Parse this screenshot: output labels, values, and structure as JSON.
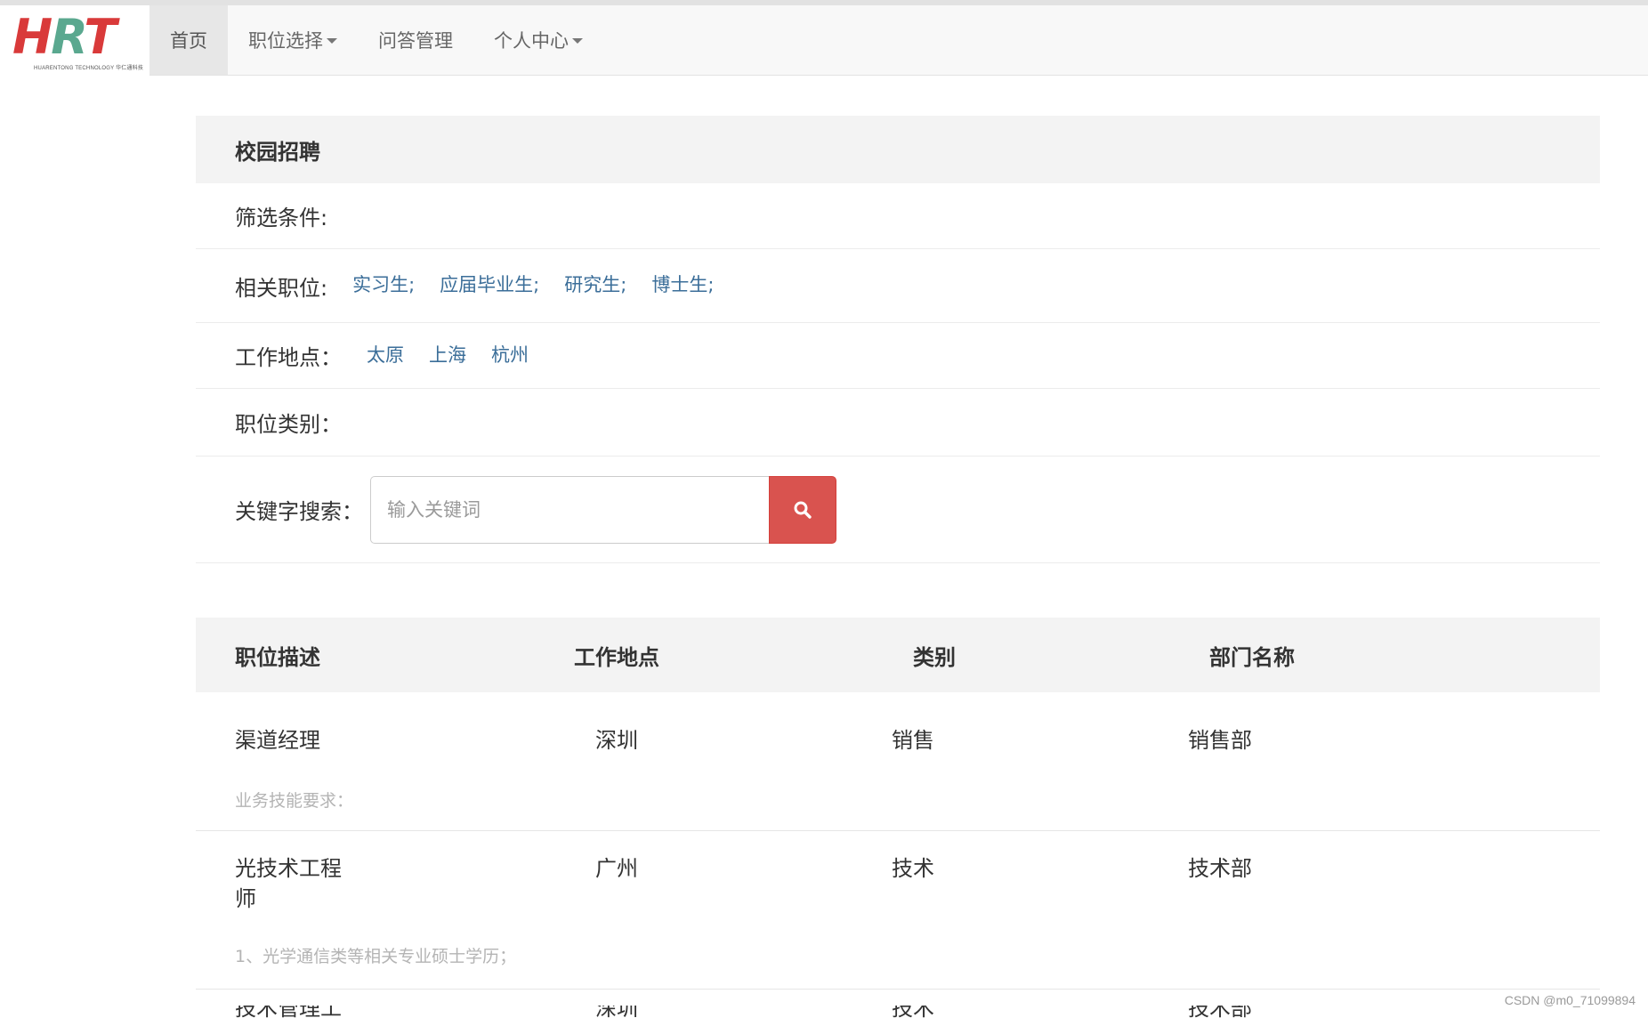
{
  "brand": {
    "logo_text": "HRT",
    "logo_sub": "HUARENTONG TECHNOLOGY 华仁通科技"
  },
  "nav": {
    "home": "首页",
    "positions": "职位选择",
    "qa": "问答管理",
    "profile": "个人中心"
  },
  "filter": {
    "title": "校园招聘",
    "conditions_label": "筛选条件:",
    "related_label": "相关职位:",
    "related_options": [
      "实习生;",
      "应届毕业生;",
      "研究生;",
      "博士生;"
    ],
    "location_label": "工作地点：",
    "location_options": [
      "太原",
      "上海",
      "杭州"
    ],
    "category_label": "职位类别：",
    "keyword_label": "关键字搜索：",
    "keyword_placeholder": "输入关键词"
  },
  "table": {
    "headers": [
      "职位描述",
      "工作地点",
      "类别",
      "部门名称"
    ],
    "rows": [
      {
        "name": "渠道经理",
        "location": "深圳",
        "category": "销售",
        "department": "销售部",
        "desc": "业务技能要求："
      },
      {
        "name_line1": "光技术工程",
        "name_line2": "师",
        "location": "广州",
        "category": "技术",
        "department": "技术部",
        "desc": "1、光学通信类等相关专业硕士学历；"
      },
      {
        "name": "技术管理工",
        "location": "深圳",
        "category": "技术",
        "department": "技术部"
      }
    ]
  },
  "watermark": "CSDN @m0_71099894",
  "colors": {
    "link": "#3b6e99",
    "search_button": "#d9534f",
    "logo_red": "#d93a3a",
    "logo_green": "#5aa88f"
  }
}
